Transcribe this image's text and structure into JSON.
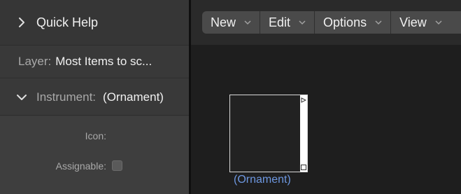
{
  "inspector": {
    "quick_help": {
      "title": "Quick Help"
    },
    "layer": {
      "key": "Layer:",
      "value": "Most Items to sc..."
    },
    "instrument": {
      "key": "Instrument:",
      "value": "(Ornament)"
    },
    "properties": {
      "icon_label": "Icon:",
      "assignable_label": "Assignable:"
    }
  },
  "toolbar": {
    "menus": [
      {
        "label": "New"
      },
      {
        "label": "Edit"
      },
      {
        "label": "Options"
      },
      {
        "label": "View"
      }
    ]
  },
  "canvas": {
    "object_label": "(Ornament)"
  },
  "colors": {
    "label_link": "#6d97e0"
  }
}
